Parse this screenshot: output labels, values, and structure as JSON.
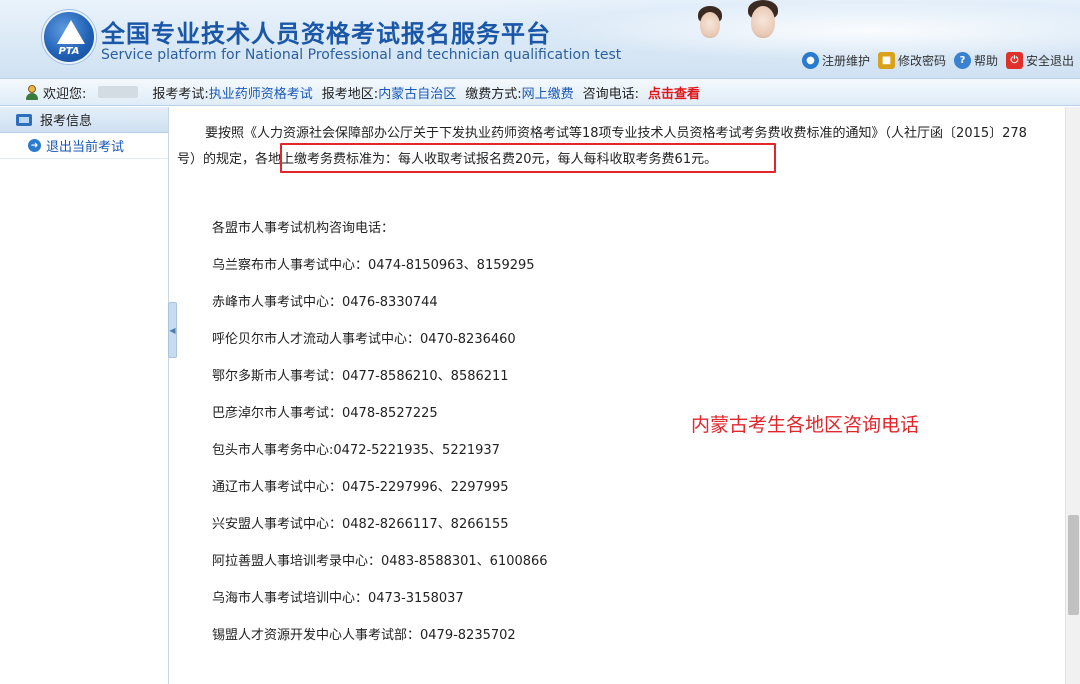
{
  "header": {
    "logo_text": "PTA",
    "title": "全国专业技术人员资格考试报名服务平台",
    "subtitle": "Service platform for National Professional and technician qualification test",
    "links": [
      {
        "label": "注册维护",
        "icon": "globe-icon",
        "color": "#2a7bd0"
      },
      {
        "label": "修改密码",
        "icon": "lock-icon",
        "color": "#d9a21a"
      },
      {
        "label": "帮助",
        "icon": "help-icon",
        "color": "#3a82d0"
      },
      {
        "label": "安全退出",
        "icon": "power-icon",
        "color": "#e0302a"
      }
    ]
  },
  "infobar": {
    "welcome_label": "欢迎您:",
    "exam_label": "报考考试:",
    "exam_value": "执业药师资格考试",
    "region_label": "报考地区:",
    "region_value": "内蒙古自治区",
    "payment_label": "缴费方式:",
    "payment_value": "网上缴费",
    "phone_label": "咨询电话:",
    "phone_link": "点击查看"
  },
  "sidebar": {
    "header": "报考信息",
    "items": [
      {
        "label": "退出当前考试"
      }
    ]
  },
  "main": {
    "paragraph_part1": "要按照《人力资源社会保障部办公厅关于下发执业药师资格考试等18项专业技术人员资格考试考务费收费标准的通知》（人社厅函〔2015〕278号）的规定，",
    "paragraph_highlight": "各地上缴考务费标准为：每人收取考试报名费20元，每人每科收取考务费61元。",
    "contacts_heading": "各盟市人事考试机构咨询电话：",
    "contacts": [
      "乌兰察布市人事考试中心：0474-8150963、8159295",
      "赤峰市人事考试中心：0476-8330744",
      "呼伦贝尔市人才流动人事考试中心：0470-8236460",
      "鄂尔多斯市人事考试：0477-8586210、8586211",
      "巴彦淖尔市人事考试：0478-8527225",
      "包头市人事考务中心:0472-5221935、5221937",
      "通辽市人事考试中心：0475-2297996、2297995",
      "兴安盟人事考试中心：0482-8266117、8266155",
      "阿拉善盟人事培训考录中心：0483-8588301、6100866",
      "乌海市人事考试培训中心：0473-3158037",
      "锡盟人才资源开发中心人事考试部：0479-8235702"
    ],
    "annotation": "内蒙古考生各地区咨询电话"
  },
  "colors": {
    "brand_blue": "#1a57a8",
    "link_blue": "#1b58b5",
    "alert_red": "#e2262b"
  }
}
